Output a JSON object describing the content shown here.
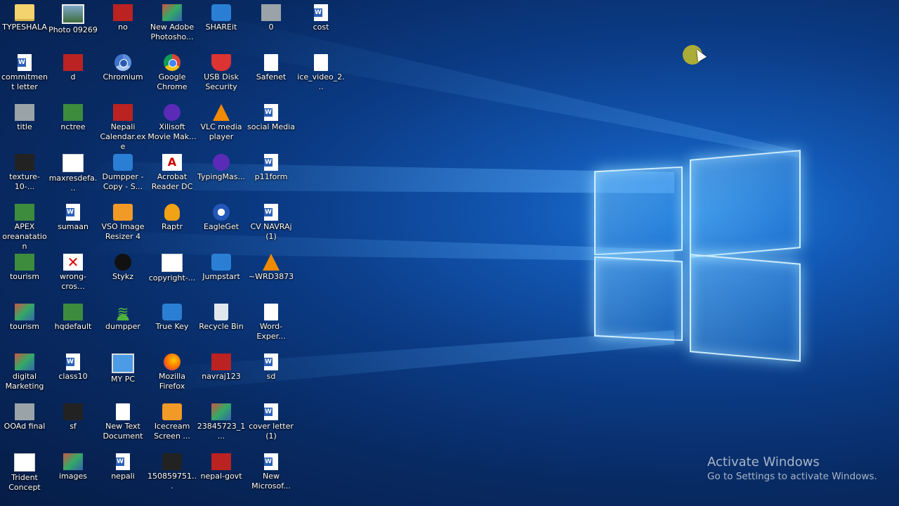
{
  "desktop": {
    "icons": [
      {
        "label": "TYPESHALA",
        "icon": "folder-icon",
        "style": "g-folder"
      },
      {
        "label": "Photo 09269",
        "icon": "photo-icon",
        "style": "g-photo"
      },
      {
        "label": "no",
        "icon": "archive-icon",
        "style": "g-red"
      },
      {
        "label": "New Adobe Photosho...",
        "icon": "photoshop-file-icon",
        "style": "g-thumb"
      },
      {
        "label": "SHAREit",
        "icon": "shareit-icon",
        "style": "g-blue"
      },
      {
        "label": "0",
        "icon": "image-file-icon",
        "style": "g-gray"
      },
      {
        "label": "cost",
        "icon": "word-document-icon",
        "style": "g-word"
      },
      {
        "label": "commitment letter",
        "icon": "word-document-icon",
        "style": "g-word"
      },
      {
        "label": "d",
        "icon": "image-file-icon",
        "style": "g-red"
      },
      {
        "label": "Chromium",
        "icon": "chromium-icon",
        "style": "g-chromium"
      },
      {
        "label": "Google Chrome",
        "icon": "chrome-icon",
        "style": "g-chrome"
      },
      {
        "label": "USB Disk Security",
        "icon": "shield-icon",
        "style": "g-shield"
      },
      {
        "label": "Safenet",
        "icon": "text-file-icon",
        "style": "g-doc"
      },
      {
        "label": "ice_video_2...",
        "icon": "video-file-icon",
        "style": "g-doc"
      },
      {
        "label": "title",
        "icon": "image-file-icon",
        "style": "g-gray"
      },
      {
        "label": "nctree",
        "icon": "image-file-icon",
        "style": "g-green"
      },
      {
        "label": "Nepali Calendar.exe",
        "icon": "calendar-app-icon",
        "style": "g-red"
      },
      {
        "label": "Xilisoft Movie Mak...",
        "icon": "movie-maker-icon",
        "style": "g-purple"
      },
      {
        "label": "VLC media player",
        "icon": "vlc-icon",
        "style": "g-vlc"
      },
      {
        "label": "social Media",
        "icon": "word-document-icon",
        "style": "g-word"
      },
      {
        "label": "texture-10-...",
        "icon": "image-file-icon",
        "style": "g-dark"
      },
      {
        "label": "maxresdefa...",
        "icon": "image-file-icon",
        "style": "g-white"
      },
      {
        "label": "Dumpper - Copy - S...",
        "icon": "app-shortcut-icon",
        "style": "g-blue"
      },
      {
        "label": "Acrobat Reader DC",
        "icon": "acrobat-icon",
        "style": "g-acrobat"
      },
      {
        "label": "TypingMas...",
        "icon": "typingmaster-icon",
        "style": "g-purple"
      },
      {
        "label": "p11form",
        "icon": "word-document-icon",
        "style": "g-word"
      },
      {
        "label": "APEX oreanatation",
        "icon": "image-file-icon",
        "style": "g-green"
      },
      {
        "label": "sumaan",
        "icon": "word-document-icon",
        "style": "g-word"
      },
      {
        "label": "VSO Image Resizer 4",
        "icon": "image-resizer-icon",
        "style": "g-orange"
      },
      {
        "label": "Raptr",
        "icon": "raptr-icon",
        "style": "g-raptr"
      },
      {
        "label": "EagleGet",
        "icon": "eagleget-icon",
        "style": "g-eagle"
      },
      {
        "label": "CV NAVRAj (1)",
        "icon": "word-document-icon",
        "style": "g-word"
      },
      {
        "label": "tourism",
        "icon": "image-file-icon",
        "style": "g-green"
      },
      {
        "label": "wrong-cros...",
        "icon": "red-cross-icon",
        "style": "g-redx"
      },
      {
        "label": "Stykz",
        "icon": "stykz-icon",
        "style": "g-stykz"
      },
      {
        "label": "copyright-...",
        "icon": "image-file-icon",
        "style": "g-white"
      },
      {
        "label": "Jumpstart",
        "icon": "jumpstart-icon",
        "style": "g-blue"
      },
      {
        "label": "~WRD3873",
        "icon": "vlc-icon",
        "style": "g-vlc"
      },
      {
        "label": "tourism",
        "icon": "image-file-icon",
        "style": "g-thumb"
      },
      {
        "label": "hqdefault",
        "icon": "image-file-icon",
        "style": "g-green"
      },
      {
        "label": "dumpper",
        "icon": "wifi-icon",
        "style": "g-wifi"
      },
      {
        "label": "True Key",
        "icon": "truekey-icon",
        "style": "g-blue"
      },
      {
        "label": "Recycle Bin",
        "icon": "recycle-bin-icon",
        "style": "g-recycle"
      },
      {
        "label": "Word-Exper...",
        "icon": "text-file-icon",
        "style": "g-doc"
      },
      {
        "label": "digital Marketing",
        "icon": "image-file-icon",
        "style": "g-thumb"
      },
      {
        "label": "class10",
        "icon": "word-document-icon",
        "style": "g-word"
      },
      {
        "label": "MY PC",
        "icon": "computer-icon",
        "style": "g-monitor"
      },
      {
        "label": "Mozilla Firefox",
        "icon": "firefox-icon",
        "style": "g-firefox"
      },
      {
        "label": "navraj123",
        "icon": "image-file-icon",
        "style": "g-red"
      },
      {
        "label": "sd",
        "icon": "word-document-icon",
        "style": "g-word"
      },
      {
        "label": "OOAd final",
        "icon": "image-file-icon",
        "style": "g-gray"
      },
      {
        "label": "sf",
        "icon": "image-file-icon",
        "style": "g-dark"
      },
      {
        "label": "New Text Document",
        "icon": "text-file-icon",
        "style": "g-doc"
      },
      {
        "label": "Icecream Screen ...",
        "icon": "icecream-recorder-icon",
        "style": "g-orange"
      },
      {
        "label": "23845723_1...",
        "icon": "image-file-icon",
        "style": "g-thumb"
      },
      {
        "label": "cover letter (1)",
        "icon": "word-document-icon",
        "style": "g-word"
      },
      {
        "label": "Trident Concept",
        "icon": "image-file-icon",
        "style": "g-white"
      },
      {
        "label": "images",
        "icon": "image-file-icon",
        "style": "g-thumb"
      },
      {
        "label": "nepali",
        "icon": "word-document-icon",
        "style": "g-word"
      },
      {
        "label": "150859751...",
        "icon": "image-file-icon",
        "style": "g-dark"
      },
      {
        "label": "nepal-govt",
        "icon": "image-file-icon",
        "style": "g-red"
      },
      {
        "label": "New Microsof...",
        "icon": "word-document-icon",
        "style": "g-word"
      }
    ]
  },
  "watermark": {
    "title": "Activate Windows",
    "subtitle": "Go to Settings to activate Windows."
  },
  "colors": {
    "accent": "#1f7ad8",
    "wallpaper_dark": "#061d47"
  }
}
